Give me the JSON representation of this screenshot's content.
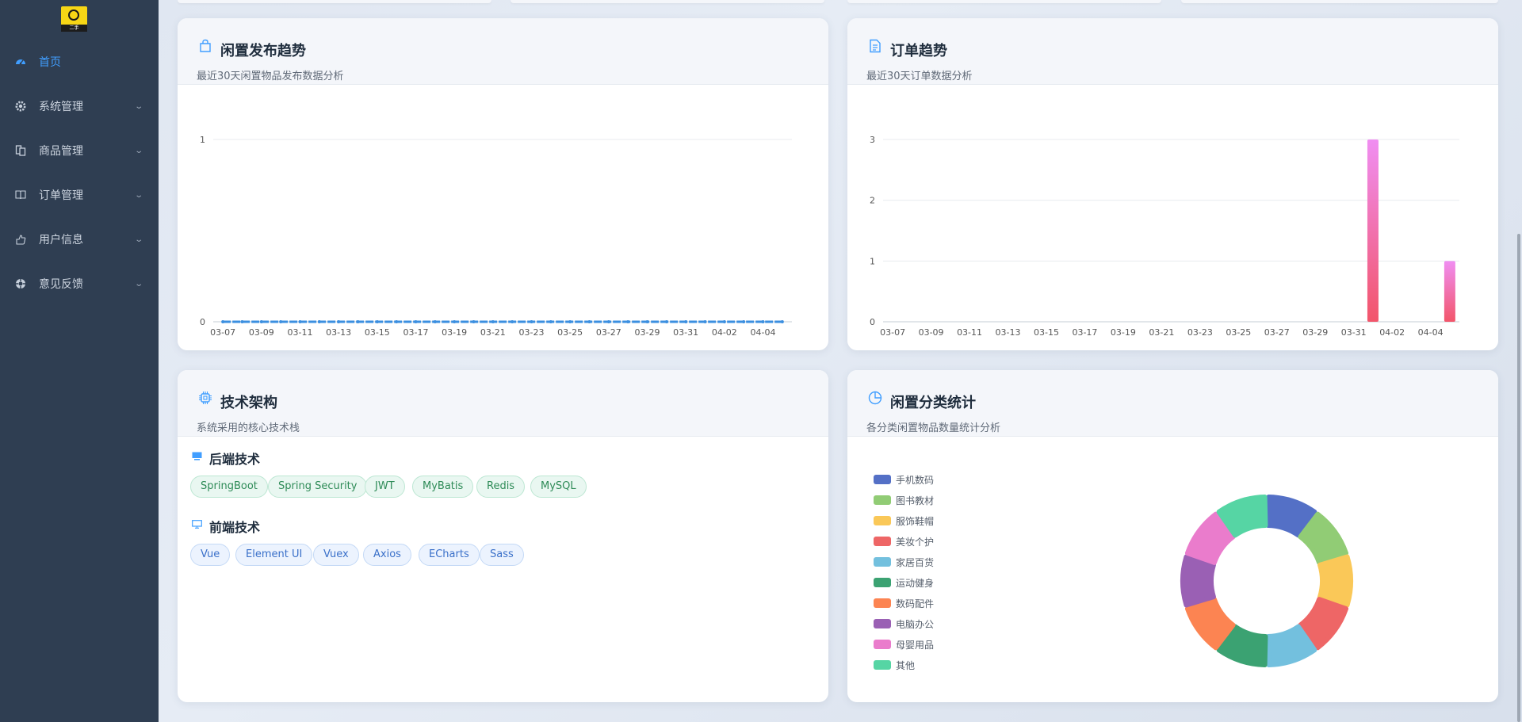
{
  "logo": {
    "text": "二手"
  },
  "sidebar": {
    "items": [
      {
        "label": "首页",
        "icon": "dashboard-icon",
        "active": true,
        "expandable": false
      },
      {
        "label": "系统管理",
        "icon": "gear-icon",
        "active": false,
        "expandable": true
      },
      {
        "label": "商品管理",
        "icon": "goods-icon",
        "active": false,
        "expandable": true
      },
      {
        "label": "订单管理",
        "icon": "book-icon",
        "active": false,
        "expandable": true
      },
      {
        "label": "用户信息",
        "icon": "user-icon",
        "active": false,
        "expandable": true
      },
      {
        "label": "意见反馈",
        "icon": "feedback-icon",
        "active": false,
        "expandable": true
      }
    ]
  },
  "cards": {
    "publish_trend": {
      "title": "闲置发布趋势",
      "subtitle": "最近30天闲置物品发布数据分析",
      "icon": "shopping-bag-icon"
    },
    "order_trend": {
      "title": "订单趋势",
      "subtitle": "最近30天订单数据分析",
      "icon": "document-icon"
    },
    "tech_stack": {
      "title": "技术架构",
      "subtitle": "系统采用的核心技术栈",
      "icon": "cpu-icon",
      "backend": {
        "title": "后端技术",
        "tags": [
          "SpringBoot",
          "Spring Security",
          "JWT",
          "MyBatis",
          "Redis",
          "MySQL"
        ]
      },
      "frontend": {
        "title": "前端技术",
        "tags": [
          "Vue",
          "Element UI",
          "Vuex",
          "Axios",
          "ECharts",
          "Sass"
        ]
      }
    },
    "category_stats": {
      "title": "闲置分类统计",
      "subtitle": "各分类闲置物品数量统计分析",
      "icon": "pie-chart-icon"
    }
  },
  "chart_data": [
    {
      "type": "line",
      "x": [
        "03-07",
        "03-08",
        "03-09",
        "03-10",
        "03-11",
        "03-12",
        "03-13",
        "03-14",
        "03-15",
        "03-16",
        "03-17",
        "03-18",
        "03-19",
        "03-20",
        "03-21",
        "03-22",
        "03-23",
        "03-24",
        "03-25",
        "03-26",
        "03-27",
        "03-28",
        "03-29",
        "03-30",
        "03-31",
        "04-01",
        "04-02",
        "04-03",
        "04-04",
        "04-05"
      ],
      "x_tick_labels": [
        "03-07",
        "03-09",
        "03-11",
        "03-13",
        "03-15",
        "03-17",
        "03-19",
        "03-21",
        "03-23",
        "03-25",
        "03-27",
        "03-29",
        "03-31",
        "04-02",
        "04-04"
      ],
      "series": [
        {
          "values": [
            0,
            0,
            0,
            0,
            0,
            0,
            0,
            0,
            0,
            0,
            0,
            0,
            0,
            0,
            0,
            0,
            0,
            0,
            0,
            0,
            0,
            0,
            0,
            0,
            0,
            0,
            0,
            0,
            0,
            0
          ]
        }
      ],
      "ylim": [
        0,
        1
      ],
      "y_ticks": [
        0,
        1
      ],
      "color": "#3b8fe0",
      "grid": true
    },
    {
      "type": "bar",
      "x": [
        "03-07",
        "03-08",
        "03-09",
        "03-10",
        "03-11",
        "03-12",
        "03-13",
        "03-14",
        "03-15",
        "03-16",
        "03-17",
        "03-18",
        "03-19",
        "03-20",
        "03-21",
        "03-22",
        "03-23",
        "03-24",
        "03-25",
        "03-26",
        "03-27",
        "03-28",
        "03-29",
        "03-30",
        "03-31",
        "04-01",
        "04-02",
        "04-03",
        "04-04",
        "04-05"
      ],
      "x_tick_labels": [
        "03-07",
        "03-09",
        "03-11",
        "03-13",
        "03-15",
        "03-17",
        "03-19",
        "03-21",
        "03-23",
        "03-25",
        "03-27",
        "03-29",
        "03-31",
        "04-02",
        "04-04"
      ],
      "series": [
        {
          "values": [
            0,
            0,
            0,
            0,
            0,
            0,
            0,
            0,
            0,
            0,
            0,
            0,
            0,
            0,
            0,
            0,
            0,
            0,
            0,
            0,
            0,
            0,
            0,
            0,
            0,
            3,
            0,
            0,
            0,
            1
          ]
        }
      ],
      "ylim": [
        0,
        3
      ],
      "y_ticks": [
        0,
        1,
        2,
        3
      ],
      "gradient": [
        "#f08ef2",
        "#f2556a"
      ],
      "grid": true
    },
    {
      "type": "pie",
      "variant": "donut",
      "legend_position": "left",
      "slices": [
        {
          "label": "手机数码",
          "value": 1,
          "color": "#5470c6"
        },
        {
          "label": "图书教材",
          "value": 1,
          "color": "#91cc75"
        },
        {
          "label": "服饰鞋帽",
          "value": 1,
          "color": "#fac858"
        },
        {
          "label": "美妆个护",
          "value": 1,
          "color": "#ee6666"
        },
        {
          "label": "家居百货",
          "value": 1,
          "color": "#73c0de"
        },
        {
          "label": "运动健身",
          "value": 1,
          "color": "#3ba272"
        },
        {
          "label": "数码配件",
          "value": 1,
          "color": "#fc8452"
        },
        {
          "label": "电脑办公",
          "value": 1,
          "color": "#9a60b4"
        },
        {
          "label": "母婴用品",
          "value": 1,
          "color": "#ea7ccc"
        },
        {
          "label": "其他",
          "value": 1,
          "color": "#56d5a4"
        }
      ]
    }
  ]
}
